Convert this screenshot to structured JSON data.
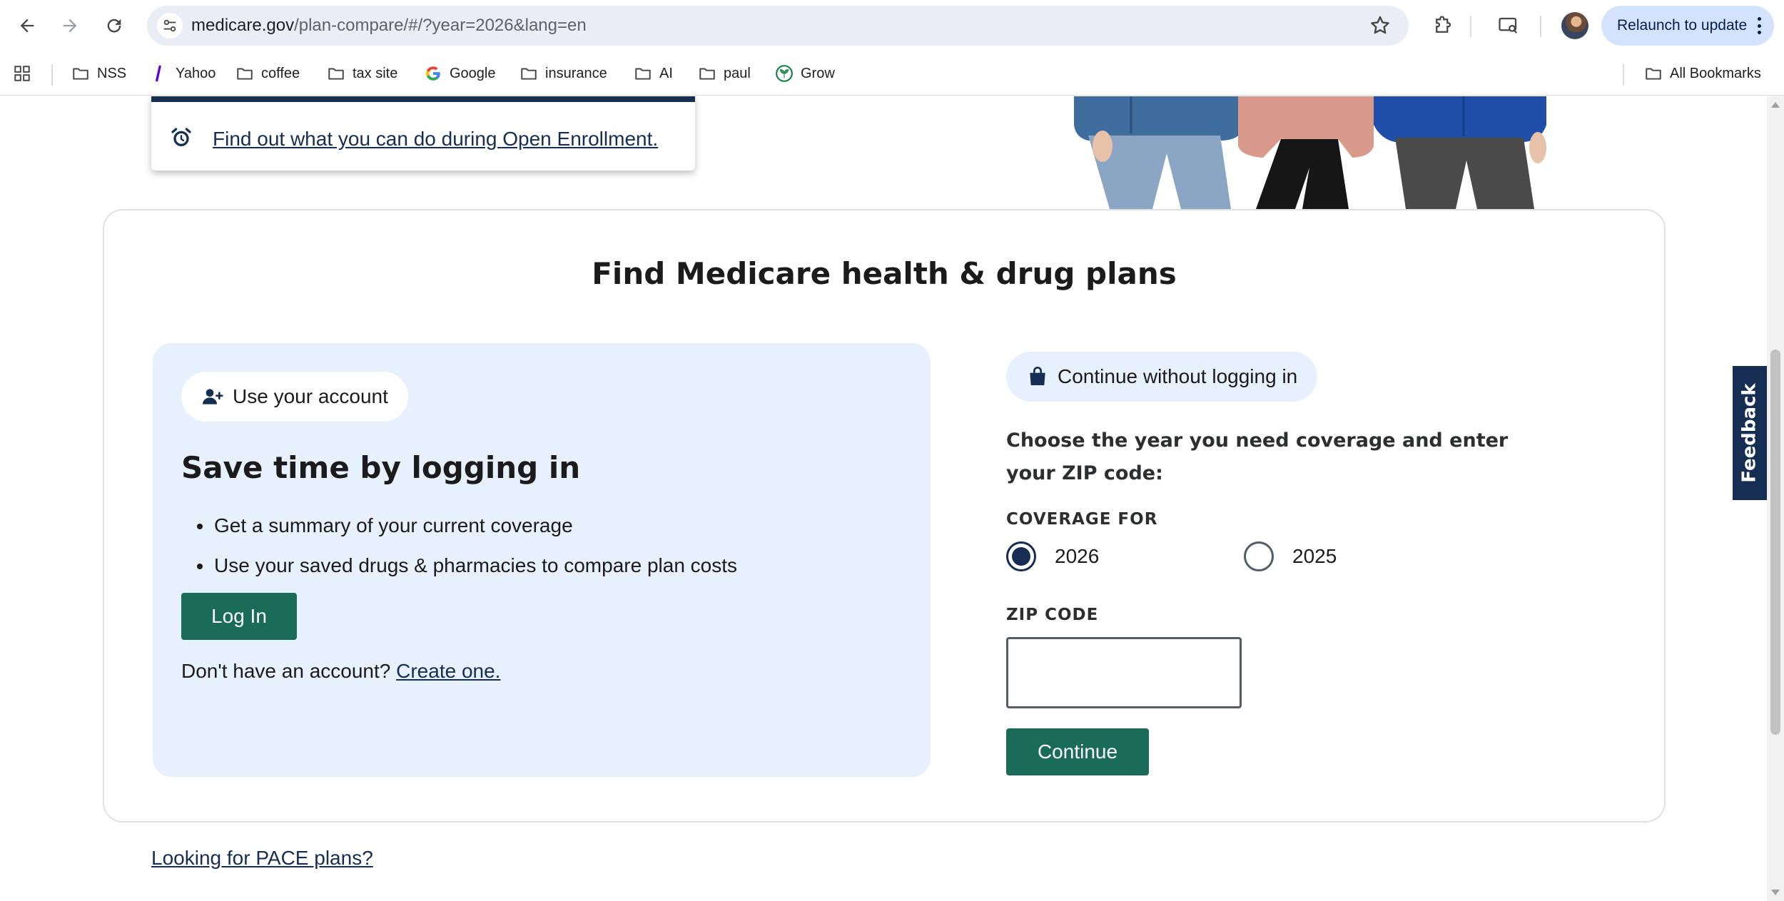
{
  "browser": {
    "url_host": "medicare.gov",
    "url_path": "/plan-compare/#/?year=2026&lang=en",
    "relaunch_label": "Relaunch to update",
    "bookmarks": [
      {
        "label": "NSS",
        "icon": "folder-icon"
      },
      {
        "label": "Yahoo",
        "icon": "yahoo-icon"
      },
      {
        "label": "coffee",
        "icon": "folder-icon"
      },
      {
        "label": "tax site",
        "icon": "folder-icon"
      },
      {
        "label": "Google",
        "icon": "google-icon"
      },
      {
        "label": "insurance",
        "icon": "folder-icon"
      },
      {
        "label": "AI",
        "icon": "folder-icon"
      },
      {
        "label": "paul",
        "icon": "folder-icon"
      },
      {
        "label": "Grow",
        "icon": "grow-icon"
      }
    ],
    "all_bookmarks_label": "All Bookmarks"
  },
  "page": {
    "enrollment_link": "Find out what you can do during Open Enrollment.",
    "card_title": "Find Medicare health & drug plans",
    "login": {
      "pill_label": "Use your account",
      "heading": "Save time by logging in",
      "benefits": [
        "Get a summary of your current coverage",
        "Use your saved drugs & pharmacies to compare plan costs"
      ],
      "login_button": "Log In",
      "no_account_text": "Don't have an account?",
      "create_link": "Create one."
    },
    "guest": {
      "pill_label": "Continue without logging in",
      "prompt": "Choose the year you need coverage and enter your ZIP code:",
      "coverage_label": "COVERAGE FOR",
      "year_options": [
        "2026",
        "2025"
      ],
      "selected_year": "2026",
      "zip_label": "ZIP CODE",
      "zip_value": "",
      "continue_button": "Continue"
    },
    "pace_link": "Looking for PACE plans?",
    "feedback_label": "Feedback"
  },
  "colors": {
    "brand_navy": "#162e51",
    "button_green": "#1a6b57",
    "panel_blue": "#e7f0fd"
  }
}
